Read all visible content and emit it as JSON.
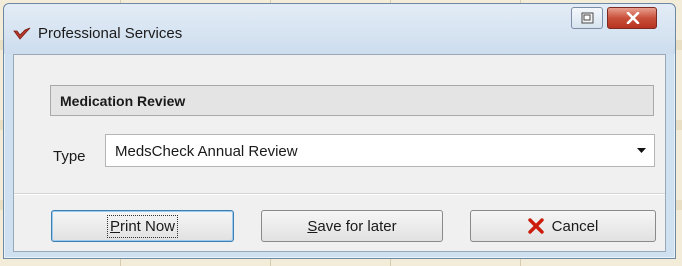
{
  "window": {
    "title": "Professional Services",
    "icon": "red-check-icon",
    "restore_icon": "restore-icon",
    "close_icon": "close-icon"
  },
  "section": {
    "header": "Medication Review"
  },
  "type_field": {
    "label": "Type",
    "value": "MedsCheck Annual Review"
  },
  "buttons": {
    "print": {
      "mnemonic": "P",
      "rest": "rint Now"
    },
    "save": {
      "mnemonic": "S",
      "rest": "ave for later"
    },
    "cancel": {
      "label": "Cancel",
      "icon": "red-x-icon"
    }
  },
  "colors": {
    "close_button": "#c9503a",
    "cancel_icon": "#cc1c0c",
    "app_icon": "#b83a2a"
  }
}
